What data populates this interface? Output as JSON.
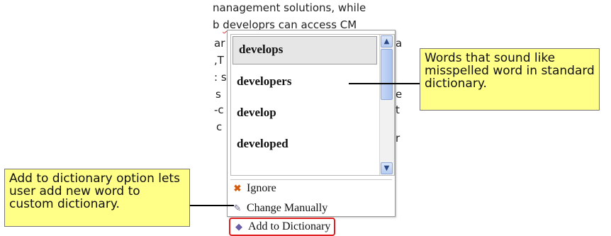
{
  "editor": {
    "line1": "nanagement solutions, while",
    "line2_prefix": "b ",
    "line2_misspelled": "developrs",
    "line2_suffix": " can access CM",
    "frag_ar": "ar",
    "frag_t": ",T",
    "frag_s1": ": s",
    "frag_s2": "s",
    "frag_dash": "-c",
    "frag_c": "c",
    "frag_right_a": "a",
    "frag_right_e": "e",
    "frag_right_t": "t",
    "frag_right_r": "r"
  },
  "spell_popup": {
    "suggestions": [
      "develops",
      "developers",
      "develop",
      "developed"
    ],
    "selected_index": 0,
    "scroll_up_glyph": "▲",
    "scroll_down_glyph": "▼",
    "menu": {
      "ignore_label": "Ignore",
      "change_label": "Change Manually",
      "add_label": "Add to Dictionary"
    }
  },
  "callouts": {
    "sound_alike": "Words that sound like misspelled word in standard dictionary.",
    "add_dictionary": "Add to dictionary option lets user add new word to custom dictionary."
  },
  "icons": {
    "ignore": "close-x-icon",
    "change": "pencil-icon",
    "add": "book-icon"
  }
}
